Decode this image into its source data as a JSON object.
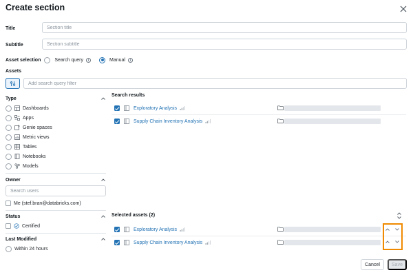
{
  "dialog": {
    "title": "Create section",
    "close_icon": "close-icon"
  },
  "form": {
    "title_label": "Title",
    "title_placeholder": "Section title",
    "subtitle_label": "Subtitle",
    "subtitle_placeholder": "Section subtitle",
    "asset_selection_label": "Asset selection",
    "asset_selection_options": [
      {
        "label": "Search query",
        "selected": false
      },
      {
        "label": "Manual",
        "selected": true
      }
    ],
    "assets_label": "Assets",
    "search_filter_placeholder": "Add search query filter"
  },
  "filters": {
    "type": {
      "header": "Type",
      "items": [
        {
          "label": "Dashboards",
          "icon": "dashboard-icon"
        },
        {
          "label": "Apps",
          "icon": "apps-icon"
        },
        {
          "label": "Genie spaces",
          "icon": "genie-icon"
        },
        {
          "label": "Metric views",
          "icon": "metric-view-icon"
        },
        {
          "label": "Tables",
          "icon": "table-icon"
        },
        {
          "label": "Notebooks",
          "icon": "notebook-icon"
        },
        {
          "label": "Models",
          "icon": "model-icon"
        }
      ]
    },
    "owner": {
      "header": "Owner",
      "search_placeholder": "Search users",
      "me_label": "Me (stef.bran@databricks.com)"
    },
    "status": {
      "header": "Status",
      "certified_label": "Certified"
    },
    "last_modified": {
      "header": "Last Modified",
      "option_24h": "Within 24 hours"
    }
  },
  "search_results": {
    "title": "Search results",
    "rows": [
      {
        "name": "Exploratory Analysis",
        "checked": true
      },
      {
        "name": "Supply Chain Inventory Analysis",
        "checked": true
      }
    ]
  },
  "selected_assets": {
    "title": "Selected assets (2)",
    "rows": [
      {
        "name": "Exploratory Analysis",
        "checked": true
      },
      {
        "name": "Supply Chain Inventory Analysis",
        "checked": true
      }
    ]
  },
  "footer": {
    "cancel_label": "Cancel",
    "save_label": "Save"
  },
  "colors": {
    "accent": "#2272b4",
    "highlight": "#f08a00"
  }
}
